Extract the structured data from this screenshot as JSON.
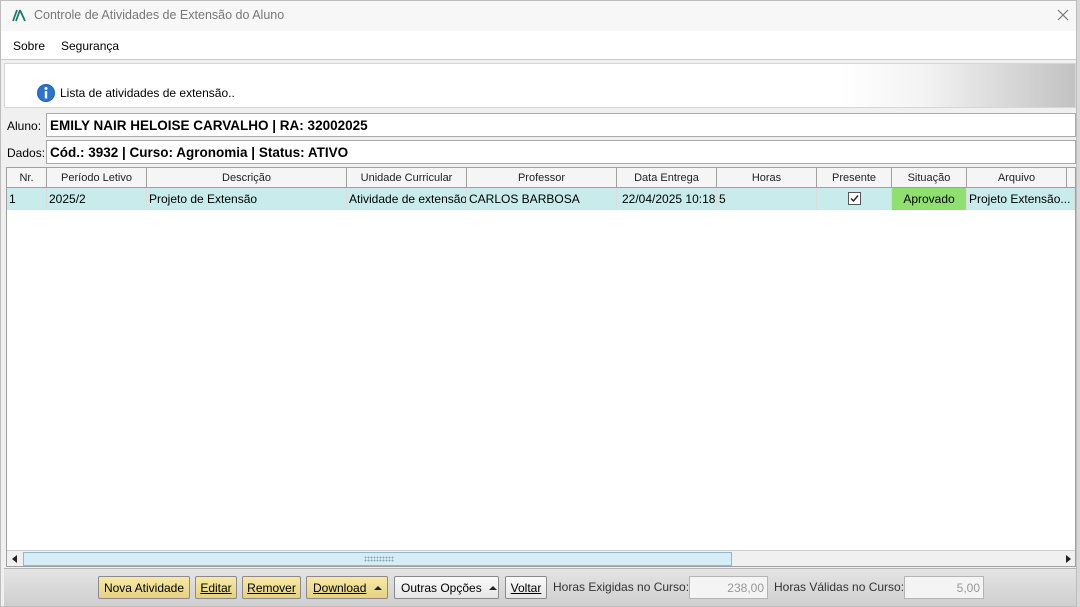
{
  "window": {
    "title": "Controle de Atividades de Extensão do Aluno"
  },
  "menu": {
    "items": [
      "Sobre",
      "Segurança"
    ]
  },
  "header": {
    "info_text": "Lista de atividades de extensão.."
  },
  "student": {
    "aluno_label": "Aluno:",
    "aluno_value": "EMILY NAIR HELOISE CARVALHO | RA: 32002025",
    "dados_label": "Dados:",
    "dados_value": "Cód.: 3932 | Curso: Agronomia | Status: ATIVO"
  },
  "grid": {
    "columns": [
      "Nr.",
      "Período Letivo",
      "Descrição",
      "Unidade Curricular",
      "Professor",
      "Data Entrega",
      "Horas",
      "Presente",
      "Situação",
      "Arquivo"
    ],
    "rows": [
      {
        "nr": "1",
        "periodo": "2025/2",
        "descricao": "Projeto de Extensão",
        "unidade": "Atividade de extensão",
        "professor": "CARLOS BARBOSA",
        "data": "22/04/2025 10:18",
        "horas": "5",
        "presente": true,
        "situacao": "Aprovado",
        "arquivo": "Projeto Extensão..."
      }
    ]
  },
  "toolbar": {
    "nova_atividade": "Nova Atividade",
    "editar": "Editar",
    "remover": "Remover",
    "download": "Download",
    "outras_opcoes": "Outras Opções",
    "voltar": "Voltar",
    "horas_exigidas_label": "Horas Exigidas no Curso:",
    "horas_exigidas_value": "238,00",
    "horas_validas_label": "Horas Válidas no Curso:",
    "horas_validas_value": "5,00"
  },
  "colors": {
    "selected_row": "#c8ecec",
    "status_approved": "#90e070",
    "yellow_button": "#f0e29a"
  }
}
